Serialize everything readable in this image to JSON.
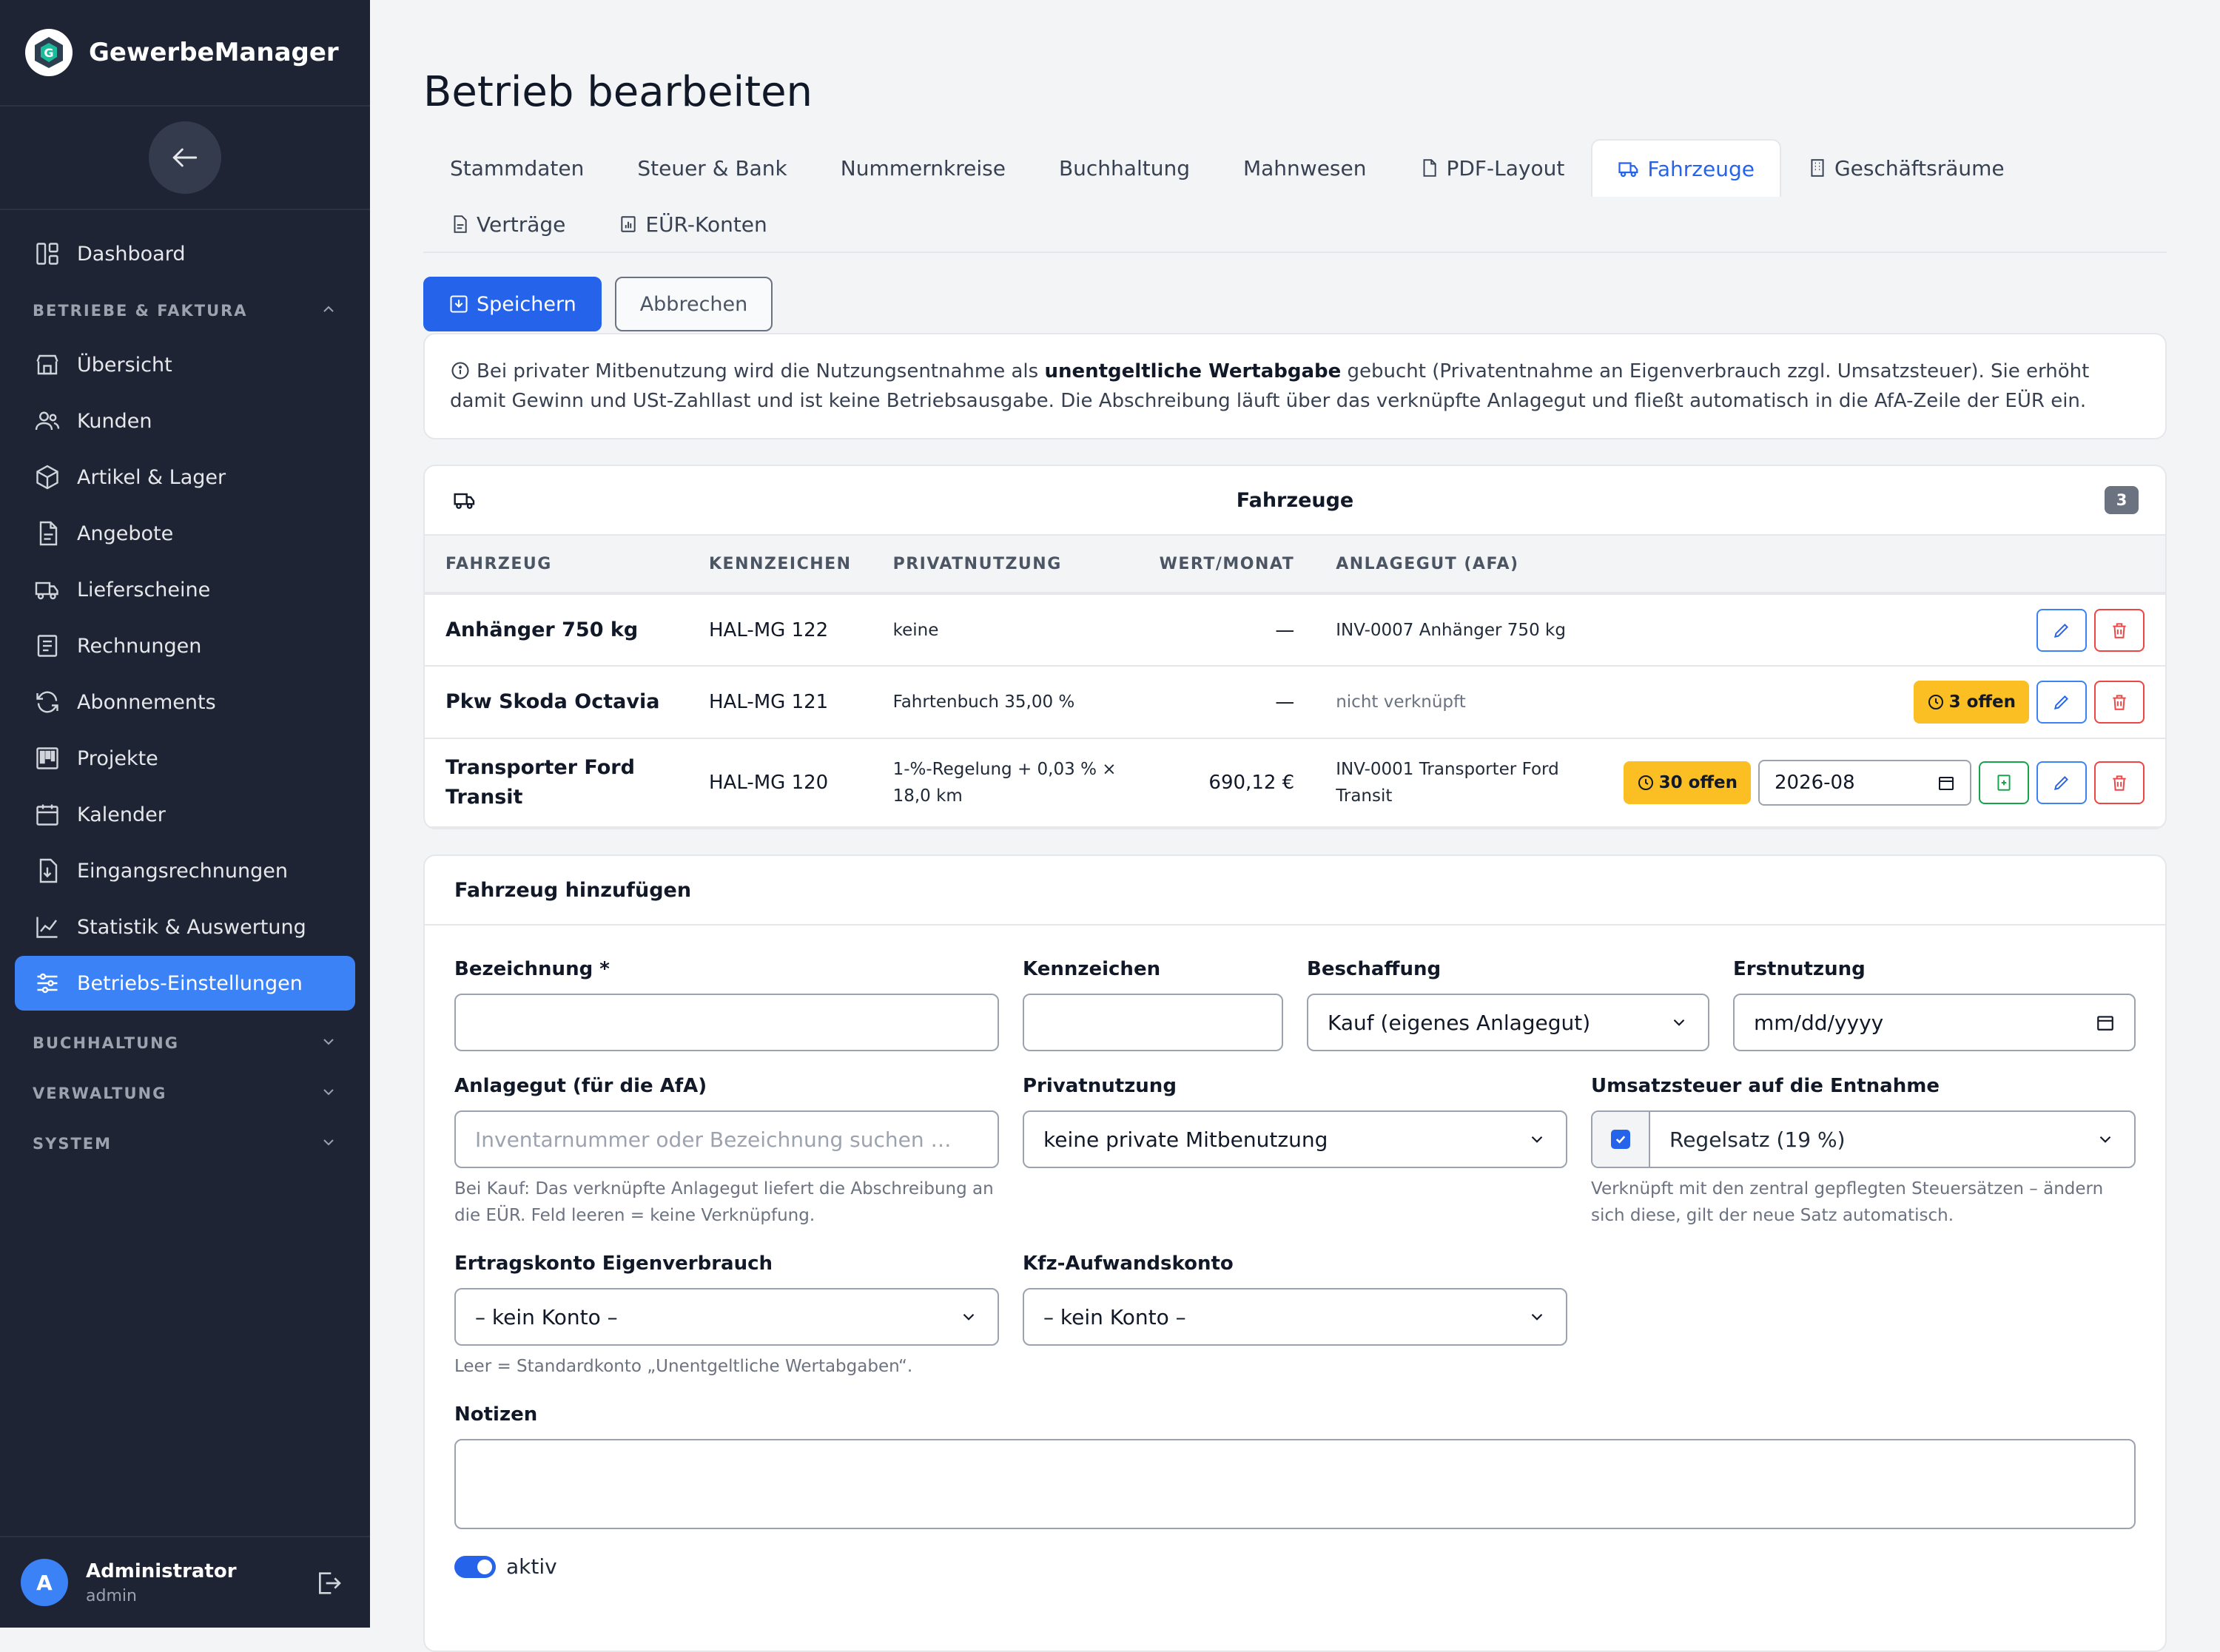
{
  "app": {
    "name": "GewerbeManager"
  },
  "sidebar": {
    "items": [
      {
        "label": "Dashboard",
        "icon": "dashboard-icon"
      },
      {
        "label": "Übersicht",
        "icon": "store-icon"
      },
      {
        "label": "Kunden",
        "icon": "users-icon"
      },
      {
        "label": "Artikel & Lager",
        "icon": "box-icon"
      },
      {
        "label": "Angebote",
        "icon": "document-icon"
      },
      {
        "label": "Lieferscheine",
        "icon": "truck-icon"
      },
      {
        "label": "Rechnungen",
        "icon": "receipt-icon"
      },
      {
        "label": "Abonnements",
        "icon": "refresh-icon"
      },
      {
        "label": "Projekte",
        "icon": "kanban-icon"
      },
      {
        "label": "Kalender",
        "icon": "calendar-icon"
      },
      {
        "label": "Eingangsrechnungen",
        "icon": "inbox-document-icon"
      },
      {
        "label": "Statistik & Auswertung",
        "icon": "chart-icon"
      },
      {
        "label": "Betriebs-Einstellungen",
        "icon": "sliders-icon"
      }
    ],
    "sections": {
      "betriebe": "BETRIEBE & FAKTURA",
      "buchhaltung": "BUCHHALTUNG",
      "verwaltung": "VERWALTUNG",
      "system": "SYSTEM"
    },
    "user": {
      "initial": "A",
      "name": "Administrator",
      "role": "admin"
    }
  },
  "page": {
    "title": "Betrieb bearbeiten",
    "tabs": [
      "Stammdaten",
      "Steuer & Bank",
      "Nummernkreise",
      "Buchhaltung",
      "Mahnwesen",
      "PDF-Layout",
      "Fahrzeuge",
      "Geschäftsräume",
      "Verträge",
      "EÜR-Konten"
    ],
    "save_label": "Speichern",
    "cancel_label": "Abbrechen",
    "info": {
      "before": "Bei privater Mitbenutzung wird die Nutzungsentnahme als ",
      "bold": "unentgeltliche Wertabgabe",
      "after": " gebucht (Privatentnahme an Eigenverbrauch zzgl. Umsatzsteuer). Sie erhöht damit Gewinn und USt-Zahllast und ist keine Betriebsausgabe. Die Abschreibung läuft über das verknüpfte Anlagegut und fließt automatisch in die AfA-Zeile der EÜR ein."
    }
  },
  "vehicles": {
    "title": "Fahrzeuge",
    "count": "3",
    "columns": [
      "FAHRZEUG",
      "KENNZEICHEN",
      "PRIVATNUTZUNG",
      "WERT/MONAT",
      "ANLAGEGUT (AFA)"
    ],
    "rows": [
      {
        "name": "Anhänger 750 kg",
        "plate": "HAL-MG 122",
        "private": "keine",
        "value": "—",
        "asset": "INV-0007 Anhänger 750 kg"
      },
      {
        "name": "Pkw Skoda Octavia",
        "plate": "HAL-MG 121",
        "private": "Fahrtenbuch 35,00 %",
        "value": "—",
        "asset": "nicht verknüpft",
        "badge": "3 offen"
      },
      {
        "name": "Transporter Ford Transit",
        "plate": "HAL-MG 120",
        "private": "1-%-Regelung + 0,03 % × 18,0 km",
        "value": "690,12 €",
        "asset": "INV-0001 Transporter Ford Transit",
        "badge": "30 offen",
        "month": "2026-08"
      }
    ]
  },
  "form": {
    "title": "Fahrzeug hinzufügen",
    "bezeichnung_label": "Bezeichnung *",
    "kennzeichen_label": "Kennzeichen",
    "beschaffung_label": "Beschaffung",
    "beschaffung_value": "Kauf (eigenes Anlagegut)",
    "erstnutzung_label": "Erstnutzung",
    "erstnutzung_placeholder": "mm/dd/yyyy",
    "anlagegut_label": "Anlagegut (für die AfA)",
    "anlagegut_placeholder": "Inventarnummer oder Bezeichnung suchen …",
    "anlagegut_help": "Bei Kauf: Das verknüpfte Anlagegut liefert die Abschreibung an die EÜR. Feld leeren = keine Verknüpfung.",
    "privatnutzung_label": "Privatnutzung",
    "privatnutzung_value": "keine private Mitbenutzung",
    "ust_label": "Umsatzsteuer auf die Entnahme",
    "ust_value": "Regelsatz (19 %)",
    "ust_help": "Verknüpft mit den zentral gepflegten Steuersätzen – ändern sich diese, gilt der neue Satz automatisch.",
    "ertrag_label": "Ertragskonto Eigenverbrauch",
    "ertrag_value": "– kein Konto –",
    "ertrag_help": "Leer = Standardkonto „Unentgeltliche Wertabgaben“.",
    "kfz_label": "Kfz-Aufwandskonto",
    "kfz_value": "– kein Konto –",
    "notizen_label": "Notizen",
    "aktiv_label": "aktiv"
  }
}
